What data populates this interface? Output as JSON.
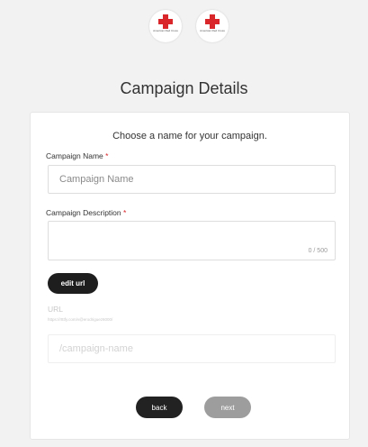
{
  "header": {
    "logos": [
      {
        "icon": "red-cross-icon",
        "text": "American Red Cross"
      },
      {
        "icon": "red-cross-icon",
        "text": "American Red Cross"
      }
    ]
  },
  "page": {
    "title": "Campaign Details",
    "subtitle": "Choose a name for your campaign."
  },
  "form": {
    "campaign_name": {
      "label": "Campaign Name",
      "required_mark": "*",
      "placeholder": "Campaign Name",
      "value": ""
    },
    "campaign_description": {
      "label": "Campaign Description",
      "required_mark": "*",
      "counter": "0 / 500",
      "value": ""
    },
    "edit_url_label": "edit url",
    "url": {
      "label": "URL",
      "value": "https://rtttfy.com/v@erodriguez6000/",
      "slug_placeholder": "/campaign-name"
    }
  },
  "buttons": {
    "back": "back",
    "next": "next"
  },
  "colors": {
    "background": "#f2f2f2",
    "required": "#d8262a",
    "primary_button": "#1e1e1e",
    "disabled_button": "#9d9d9d",
    "brand_red": "#d8262a"
  }
}
